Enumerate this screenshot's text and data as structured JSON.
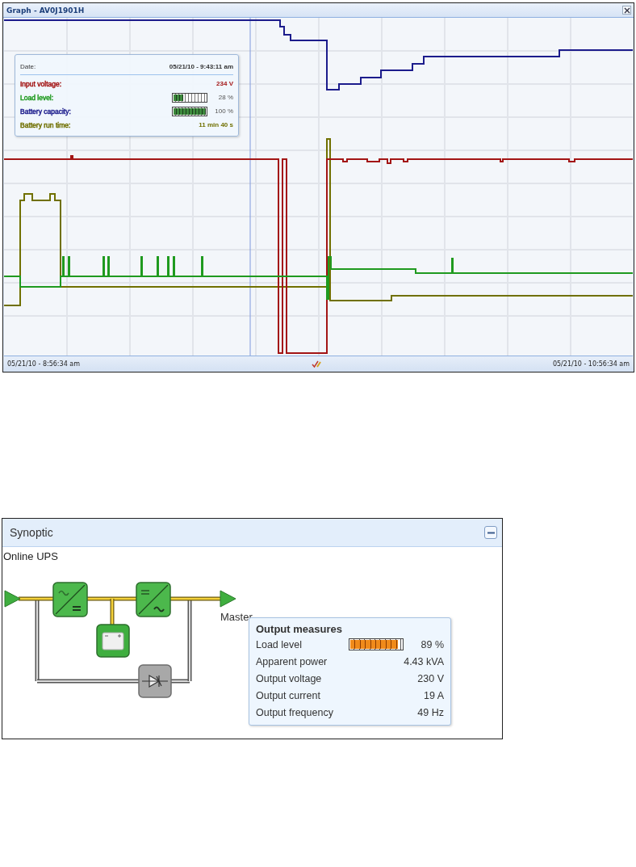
{
  "graph": {
    "title": "Graph - AV0J1901H",
    "tooltip": {
      "date_label": "Date:",
      "date": "05/21/10 - 9:43:11 am",
      "rows": [
        {
          "kind": "value",
          "label": "Input voltage:",
          "value": "234 V",
          "color": "#a31515"
        },
        {
          "kind": "meter",
          "label": "Load level:",
          "value": "28 %",
          "color": "#1f9a1f",
          "level": 0.28
        },
        {
          "kind": "meter",
          "label": "Battery capacity:",
          "value": "100 %",
          "color": "#1c1c8c",
          "level": 1
        },
        {
          "kind": "value",
          "label": "Battery run time:",
          "value": "11 min 40 s",
          "color": "#707000"
        }
      ]
    },
    "footer": {
      "start": "05/21/10 - 8:56:34 am",
      "end": "05/21/10 - 10:56:34 am"
    }
  },
  "synoptic": {
    "title": "Synoptic",
    "subtitle": "Online UPS",
    "output_label": "Master",
    "measures": {
      "title": "Output measures",
      "rows": [
        {
          "kind": "meter",
          "label": "Load level",
          "value": "89 %",
          "level": 0.89
        },
        {
          "kind": "value",
          "label": "Apparent power",
          "value": "4.43 kVA"
        },
        {
          "kind": "value",
          "label": "Output voltage",
          "value": "230 V"
        },
        {
          "kind": "value",
          "label": "Output current",
          "value": "19 A"
        },
        {
          "kind": "value",
          "label": "Output frequency",
          "value": "49 Hz"
        }
      ]
    }
  }
}
